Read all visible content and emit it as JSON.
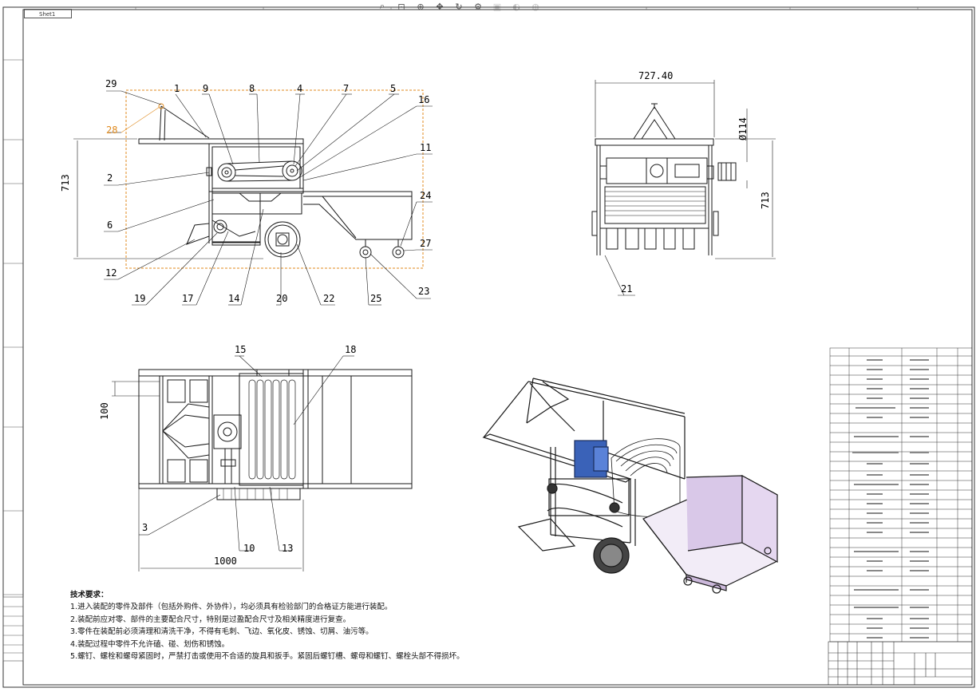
{
  "toolbar": {
    "icons": [
      "zoom-fit-icon",
      "zoom-area-icon",
      "zoom-in-out-icon",
      "pan-icon",
      "rotate-icon",
      "view-settings-icon",
      "display-style-icon",
      "hide-show-icon",
      "appearance-icon"
    ]
  },
  "sheet": {
    "tab_label": "Shet1"
  },
  "dimensions": {
    "front_height": "713",
    "side_width": "727.40",
    "side_diameter": "Ø114",
    "side_height": "713",
    "top_offset": "100",
    "top_length": "1000"
  },
  "balloons": {
    "front_top": [
      "29",
      "1",
      "9",
      "8",
      "4",
      "7",
      "5",
      "16"
    ],
    "front_selected": "28",
    "front_right": [
      "11",
      "24",
      "27"
    ],
    "front_left": [
      "2",
      "6",
      "12"
    ],
    "front_bottom": [
      "19",
      "17",
      "14",
      "20",
      "22",
      "25",
      "23"
    ],
    "side": [
      "21"
    ],
    "top_view": [
      "15",
      "18",
      "3",
      "10",
      "13"
    ]
  },
  "notes": {
    "title": "技术要求：",
    "items": [
      "1.进入装配的零件及部件（包括外购件、外协件），均必须具有检验部门的合格证方能进行装配。",
      "2.装配前应对零、部件的主要配合尺寸，特别是过盈配合尺寸及相关精度进行复查。",
      "3.零件在装配前必须清理和清洗干净，不得有毛刺、飞边、氧化皮、锈蚀、切屑、油污等。",
      "4.装配过程中零件不允许磕、碰、划伤和锈蚀。",
      "5.螺钉、螺栓和螺母紧固时，严禁打击或使用不合适的旋具和扳手。紧固后螺钉槽、螺母和螺钉、螺栓头部不得损坏。"
    ]
  },
  "colors": {
    "line": "#1a1a1a",
    "selected": "#e08a1e",
    "motor": "#3a62b8",
    "hopper": "#d9c8e8"
  }
}
